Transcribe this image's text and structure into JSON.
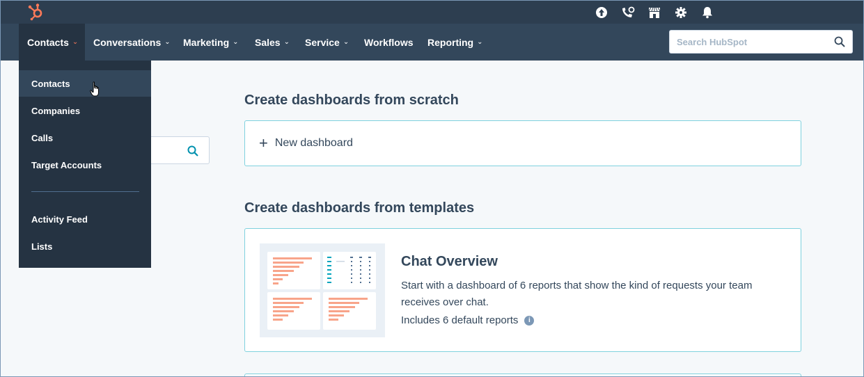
{
  "topbar": {
    "icons": [
      "upgrade-arrow-icon",
      "calling-icon",
      "marketplace-icon",
      "settings-gear-icon",
      "notifications-bell-icon"
    ],
    "logo": "hubspot-sprocket-logo"
  },
  "nav": {
    "items": [
      {
        "label": "Contacts",
        "has_chevron": true
      },
      {
        "label": "Conversations",
        "has_chevron": true
      },
      {
        "label": "Marketing",
        "has_chevron": true
      },
      {
        "label": "Sales",
        "has_chevron": true
      },
      {
        "label": "Service",
        "has_chevron": true
      },
      {
        "label": "Workflows",
        "has_chevron": false
      },
      {
        "label": "Reporting",
        "has_chevron": true
      }
    ],
    "search_placeholder": "Search HubSpot"
  },
  "dropdown": {
    "items": [
      {
        "label": "Contacts"
      },
      {
        "label": "Companies"
      },
      {
        "label": "Calls"
      },
      {
        "label": "Target Accounts"
      },
      {
        "label": "Activity Feed"
      },
      {
        "label": "Lists"
      }
    ]
  },
  "main": {
    "scratch_heading": "Create dashboards from scratch",
    "new_dashboard_label": "New dashboard",
    "templates_heading": "Create dashboards from templates",
    "template": {
      "title": "Chat Overview",
      "description": "Start with a dashboard of 6 reports that show the kind of requests your team receives over chat.",
      "count_text": "Includes 6 default reports"
    }
  },
  "colors": {
    "nav_bg": "#33475b",
    "accent_orange": "#ff7a59",
    "card_border": "#7fd1de",
    "text": "#33475b"
  }
}
